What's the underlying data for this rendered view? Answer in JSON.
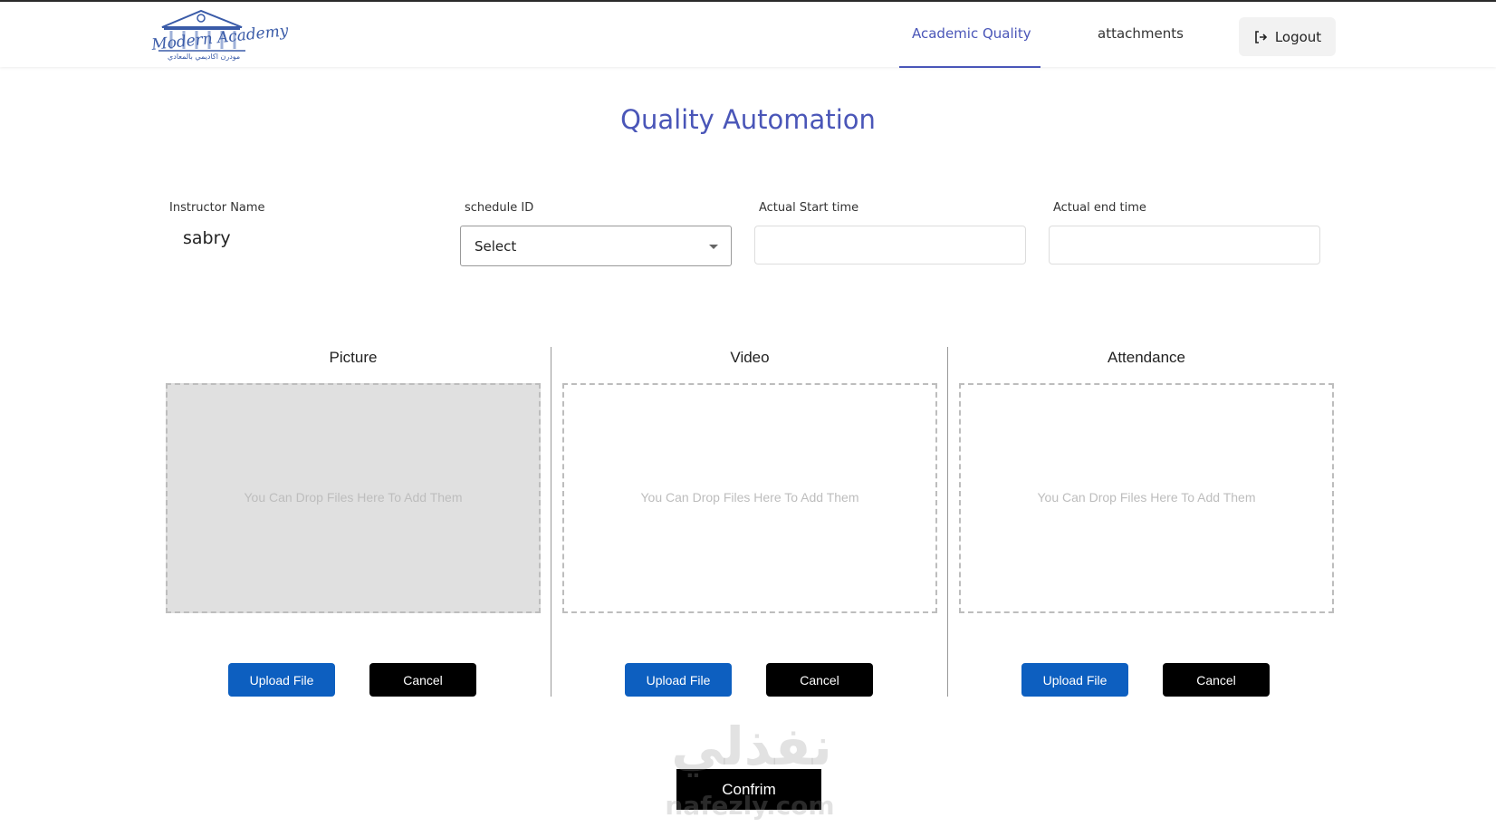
{
  "navbar": {
    "logo": {
      "text": "Modern Academy",
      "subtext": "مودرن اكاديمي بالمعادي",
      "icon": "building-columns-icon"
    },
    "links": [
      {
        "label": "Academic Quality",
        "active": true
      },
      {
        "label": "attachments",
        "active": false
      }
    ],
    "logout_label": "Logout",
    "logout_icon": "logout-icon",
    "active_color": "#4a56b8"
  },
  "page": {
    "title": "Quality Automation"
  },
  "form": {
    "instructor_label": "Instructor Name",
    "instructor_value": "sabry",
    "schedule_label": "schedule ID",
    "schedule_selected": "Select",
    "start_label": "Actual Start time",
    "start_value": "",
    "end_label": "Actual end time",
    "end_value": ""
  },
  "uploads": [
    {
      "title": "Picture",
      "drop_text": "You Can Drop Files Here To Add Them",
      "upload_label": "Upload File",
      "cancel_label": "Cancel",
      "has_file": true
    },
    {
      "title": "Video",
      "drop_text": "You Can Drop Files Here To Add Them",
      "upload_label": "Upload File",
      "cancel_label": "Cancel",
      "has_file": false
    },
    {
      "title": "Attendance",
      "drop_text": "You Can Drop Files Here To Add Them",
      "upload_label": "Upload File",
      "cancel_label": "Cancel",
      "has_file": false
    }
  ],
  "confirm_label": "Confrim",
  "watermark": {
    "arabic": "نفذلي",
    "latin": "nafezly.com"
  },
  "colors": {
    "primary": "#4a56b8",
    "upload_button": "#0d5fc0",
    "cancel_button": "#000000"
  }
}
